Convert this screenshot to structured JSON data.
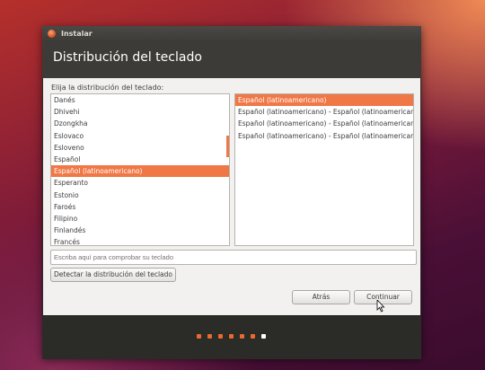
{
  "window": {
    "title": "Instalar"
  },
  "header": {
    "title": "Distribución del teclado"
  },
  "prompt": "Elija la distribución del teclado:",
  "layouts": [
    "Danés",
    "Dhivehi",
    "Dzongkha",
    "Eslovaco",
    "Esloveno",
    "Español",
    "Español (latinoamericano)",
    "Esperanto",
    "Estonio",
    "Faroés",
    "Filipino",
    "Finlandés",
    "Francés"
  ],
  "layouts_selected_index": 6,
  "variants": [
    "Español (latinoamericano)",
    "Español (latinoamericano) - Español (latinoamericano, eliminar teclas muertas)",
    "Español (latinoamericano) - Español (latinoamericano, incluir tilde muerta)",
    "Español (latinoamericano) - Español (latinoamericano, teclas muertas de Sun)"
  ],
  "variants_selected_index": 0,
  "test_input": {
    "placeholder": "Escriba aquí para comprobar su teclado",
    "value": ""
  },
  "buttons": {
    "detect": "Detectar la distribución del teclado",
    "back": "Atrás",
    "continue": "Continuar"
  },
  "progress": {
    "total_steps": 7,
    "current_step": 7
  },
  "colors": {
    "accent": "#f07746",
    "dot_inactive": "#e86a2d",
    "dot_current": "#ffffff"
  }
}
